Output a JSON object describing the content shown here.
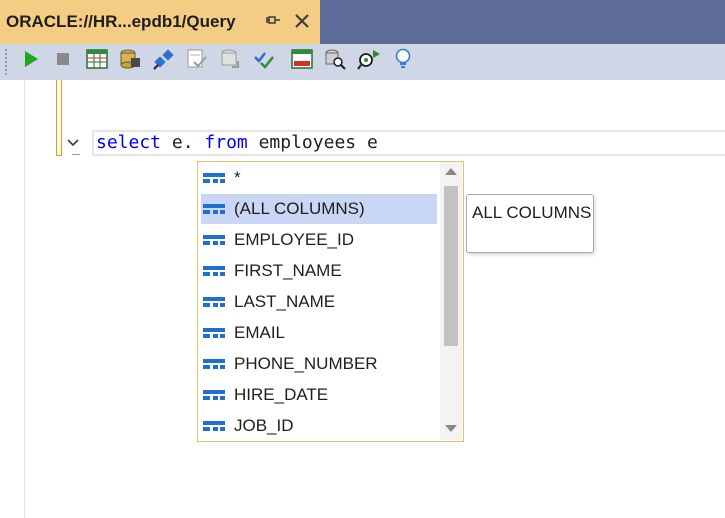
{
  "tab": {
    "title": "ORACLE://HR...epdb1/Query",
    "pin_icon": "pin-icon",
    "close_icon": "close-icon"
  },
  "toolbar": {
    "buttons": [
      {
        "name": "execute-button",
        "icon": "play-icon",
        "color": "#1ea81e"
      },
      {
        "name": "stop-button",
        "icon": "stop-icon",
        "color": "#8a8a8a"
      },
      {
        "name": "results-grid-button",
        "icon": "grid-icon",
        "color": "#2e8b3a"
      },
      {
        "name": "object-browser-button",
        "icon": "database-icon",
        "color": "#b08a2c"
      },
      {
        "name": "connection-button",
        "icon": "plug-icon",
        "color": "#2f6fcf"
      },
      {
        "name": "commit-button",
        "icon": "commit-icon",
        "color": "#9a9a9a"
      },
      {
        "name": "rollback-button",
        "icon": "rollback-icon",
        "color": "#9a9a9a"
      },
      {
        "name": "analyze-button",
        "icon": "check-double-icon",
        "color": "#2f6fcf"
      },
      {
        "name": "results-window-button",
        "icon": "window-icon",
        "color": "#d03030"
      },
      {
        "name": "query-plan-button",
        "icon": "magnifier-db-icon",
        "color": "#6a6a6a"
      },
      {
        "name": "search-next-button",
        "icon": "search-arrow-icon",
        "color": "#2e8b3a"
      },
      {
        "name": "hint-button",
        "icon": "lightbulb-icon",
        "color": "#3a7bd5"
      }
    ]
  },
  "editor": {
    "line_keyword_select": "select",
    "line_middle": " e. ",
    "line_keyword_from": "from",
    "line_tail": " employees e"
  },
  "completion": {
    "items": [
      {
        "label": "*",
        "selected": false
      },
      {
        "label": "(ALL COLUMNS)",
        "selected": true
      },
      {
        "label": "EMPLOYEE_ID",
        "selected": false
      },
      {
        "label": "FIRST_NAME",
        "selected": false
      },
      {
        "label": "LAST_NAME",
        "selected": false
      },
      {
        "label": "EMAIL",
        "selected": false
      },
      {
        "label": "PHONE_NUMBER",
        "selected": false
      },
      {
        "label": "HIRE_DATE",
        "selected": false
      },
      {
        "label": "JOB_ID",
        "selected": false
      }
    ],
    "item_icon": "column-icon",
    "tooltip": "ALL COLUMNS"
  },
  "colors": {
    "tab_active": "#f5cc84",
    "tab_strip": "#5d6b99",
    "toolbar": "#cfd6e5",
    "keyword": "#0000ff",
    "selection": "#c9d6f5",
    "column_icon": "#1e6fcf"
  }
}
